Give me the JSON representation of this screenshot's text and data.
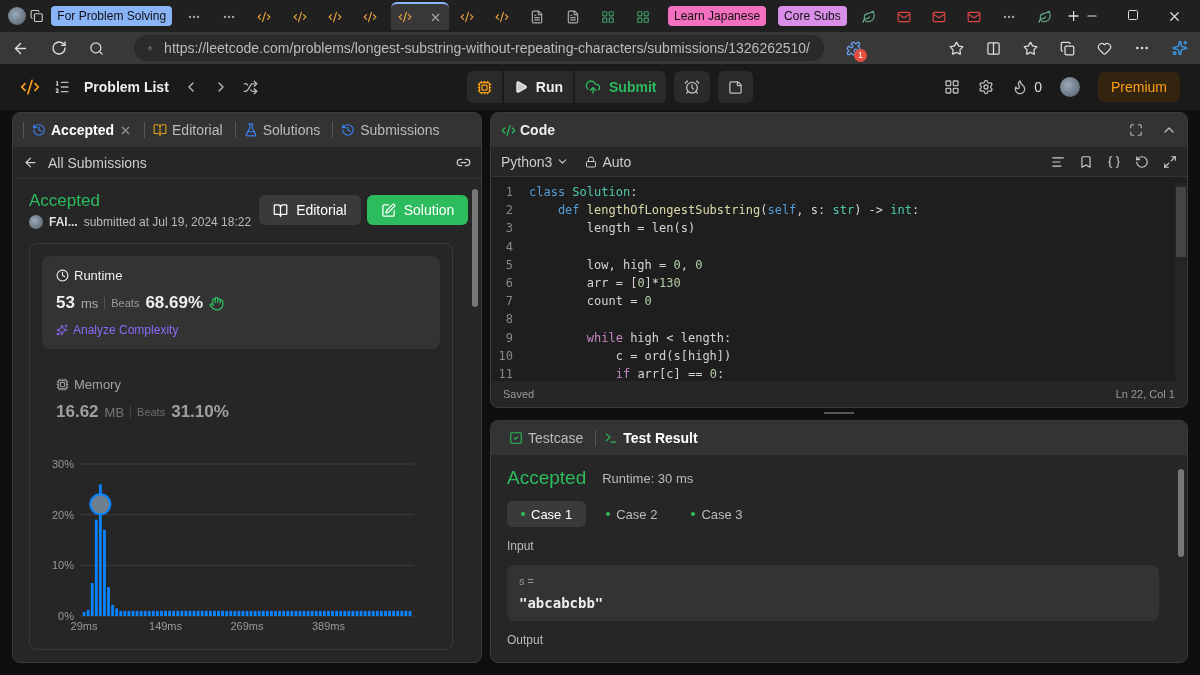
{
  "browser": {
    "tabs": [
      {
        "kind": "group",
        "label": "For Problem Solving",
        "color": "#8ab4f8"
      },
      {
        "kind": "favicon",
        "selected": false
      },
      {
        "kind": "favicon",
        "selected": false
      },
      {
        "kind": "favicon",
        "selected": false
      },
      {
        "kind": "favicon",
        "selected": false
      },
      {
        "kind": "favicon",
        "selected": false
      },
      {
        "kind": "favicon",
        "selected": false
      },
      {
        "kind": "favicon",
        "selected": true
      },
      {
        "kind": "favicon",
        "selected": false
      },
      {
        "kind": "favicon",
        "selected": false
      },
      {
        "kind": "favicon",
        "selected": false
      },
      {
        "kind": "favicon",
        "selected": false
      },
      {
        "kind": "favicon",
        "selected": false
      },
      {
        "kind": "favicon",
        "selected": false
      },
      {
        "kind": "group",
        "label": "Learn Japanese",
        "color": "#f36fc0"
      },
      {
        "kind": "group",
        "label": "Core Subs",
        "color": "#d98ee8"
      },
      {
        "kind": "favicon",
        "selected": false
      },
      {
        "kind": "favicon",
        "selected": false
      },
      {
        "kind": "favicon",
        "selected": false
      },
      {
        "kind": "favicon",
        "selected": false
      },
      {
        "kind": "favicon",
        "selected": false
      },
      {
        "kind": "favicon",
        "selected": false
      }
    ],
    "address": "https://leetcode.com/problems/longest-substring-without-repeating-characters/submissions/1326262510/",
    "extension_badge": "1"
  },
  "nav": {
    "problem_list": "Problem List",
    "run": "Run",
    "submit": "Submit",
    "streak": "0",
    "premium": "Premium"
  },
  "left": {
    "tabs": [
      {
        "label": "Accepted",
        "selected": true,
        "closable": true
      },
      {
        "label": "Editorial",
        "selected": false,
        "closable": false
      },
      {
        "label": "Solutions",
        "selected": false,
        "closable": false
      },
      {
        "label": "Submissions",
        "selected": false,
        "closable": false
      }
    ],
    "back": "All Submissions",
    "status": "Accepted",
    "user": "FAI...",
    "submitted": "submitted at Jul 19, 2024 18:22",
    "buttons": [
      {
        "label": "Editorial",
        "kind": "secondary"
      },
      {
        "label": "Solution",
        "kind": "primary"
      }
    ],
    "metrics": [
      {
        "kind": "runtime",
        "title": "Runtime",
        "value": "53",
        "unit": "ms",
        "beats_label": "Beats",
        "beats": "68.69%",
        "selected": true,
        "action": "Analyze Complexity"
      },
      {
        "kind": "memory",
        "title": "Memory",
        "value": "16.62",
        "unit": "MB",
        "beats_label": "Beats",
        "beats": "31.10%",
        "selected": false
      }
    ],
    "chart_data": {
      "type": "bar",
      "x": [
        29,
        35,
        41,
        47,
        53,
        59,
        65,
        71,
        77,
        83,
        89,
        95,
        101,
        107,
        113,
        119,
        125,
        131,
        137,
        143,
        149,
        155,
        161,
        167,
        173,
        179,
        185,
        191,
        197,
        203,
        209,
        215,
        221,
        227,
        233,
        239,
        245,
        251,
        257,
        263,
        269,
        275,
        281,
        287,
        293,
        299,
        305,
        311,
        317,
        323,
        329,
        335,
        341,
        347,
        353,
        359,
        365,
        371,
        377,
        383,
        389,
        395,
        401,
        407,
        413,
        419,
        425,
        431,
        437,
        443,
        449,
        455,
        461,
        467,
        473,
        479,
        485,
        491,
        497,
        503,
        509
      ],
      "series": [
        {
          "color": "#0a84ff",
          "values": [
            0.8,
            1.2,
            6.5,
            19,
            26,
            17,
            5.7,
            2.2,
            1.5,
            1,
            1,
            1,
            1,
            1,
            1,
            1,
            1,
            1,
            1,
            1,
            1,
            1,
            1,
            1,
            1,
            1,
            1,
            1,
            1,
            1,
            1,
            1,
            1,
            1,
            1,
            1,
            1,
            1,
            1,
            1,
            1,
            1,
            1,
            1,
            1,
            1,
            1,
            1,
            1,
            1,
            1,
            1,
            1,
            1,
            1,
            1,
            1,
            1,
            1,
            1,
            1,
            1,
            1,
            1,
            1,
            1,
            1,
            1,
            1,
            1,
            1,
            1,
            1,
            1,
            1,
            1,
            1,
            1,
            1,
            1,
            1
          ]
        }
      ],
      "xlim": [
        23,
        515
      ],
      "ylim": [
        0,
        30
      ],
      "yticks": [
        {
          "value": 0,
          "label": "0%"
        },
        {
          "value": 10,
          "label": "10%"
        },
        {
          "value": 20,
          "label": "20%"
        },
        {
          "value": 30,
          "label": "30%"
        }
      ],
      "xticks": [
        {
          "value": 29,
          "label": "29ms"
        },
        {
          "value": 149,
          "label": "149ms"
        },
        {
          "value": 269,
          "label": "269ms"
        },
        {
          "value": 389,
          "label": "389ms"
        }
      ]
    }
  },
  "code": {
    "title": "Code",
    "language": "Python3",
    "mode": "Auto",
    "lines": [
      {
        "n": "1",
        "tokens": [
          {
            "text": "class",
            "kind": "keyword"
          },
          {
            "text": " Solution",
            "kind": "type"
          },
          {
            "text": ":",
            "kind": "plain"
          }
        ]
      },
      {
        "n": "2",
        "tokens": [
          {
            "text": "    def",
            "kind": "keyword"
          },
          {
            "text": " lengthOfLongestSubstring",
            "kind": "function"
          },
          {
            "text": "(",
            "kind": "plain"
          },
          {
            "text": "self",
            "kind": "keyword"
          },
          {
            "text": ", s: ",
            "kind": "plain"
          },
          {
            "text": "str",
            "kind": "type"
          },
          {
            "text": ") -> ",
            "kind": "plain"
          },
          {
            "text": "int",
            "kind": "type"
          },
          {
            "text": ":",
            "kind": "plain"
          }
        ]
      },
      {
        "n": "3",
        "tokens": [
          {
            "text": "        length = len(s)",
            "kind": "plain"
          }
        ]
      },
      {
        "n": "4"
      },
      {
        "n": "5",
        "tokens": [
          {
            "text": "        low, high = ",
            "kind": "plain"
          },
          {
            "text": "0",
            "kind": "number"
          },
          {
            "text": ", ",
            "kind": "plain"
          },
          {
            "text": "0",
            "kind": "number"
          }
        ]
      },
      {
        "n": "6",
        "tokens": [
          {
            "text": "        arr = [",
            "kind": "plain"
          },
          {
            "text": "0",
            "kind": "number"
          },
          {
            "text": "]*",
            "kind": "plain"
          },
          {
            "text": "130",
            "kind": "number"
          }
        ]
      },
      {
        "n": "7",
        "tokens": [
          {
            "text": "        count = ",
            "kind": "plain"
          },
          {
            "text": "0",
            "kind": "number"
          }
        ]
      },
      {
        "n": "8"
      },
      {
        "n": "9",
        "tokens": [
          {
            "text": "        while",
            "kind": "control"
          },
          {
            "text": " high < length:",
            "kind": "plain"
          }
        ]
      },
      {
        "n": "10",
        "tokens": [
          {
            "text": "            c = ord(s[high])",
            "kind": "plain"
          }
        ]
      },
      {
        "n": "11",
        "tokens": [
          {
            "text": "            if",
            "kind": "control"
          },
          {
            "text": " arr[c] == ",
            "kind": "plain"
          },
          {
            "text": "0",
            "kind": "number"
          },
          {
            "text": ":",
            "kind": "plain"
          }
        ]
      }
    ],
    "saved": "Saved",
    "cursor": "Ln 22, Col 1"
  },
  "result": {
    "tabs": [
      {
        "label": "Testcase",
        "selected": false
      },
      {
        "label": "Test Result",
        "selected": true
      }
    ],
    "status": "Accepted",
    "runtime": "Runtime: 30 ms",
    "cases": [
      {
        "label": "Case 1",
        "selected": true
      },
      {
        "label": "Case 2",
        "selected": false
      },
      {
        "label": "Case 3",
        "selected": false
      }
    ],
    "input_label": "Input",
    "var": "s =",
    "value": "\"abcabcbb\"",
    "output_label": "Output"
  }
}
